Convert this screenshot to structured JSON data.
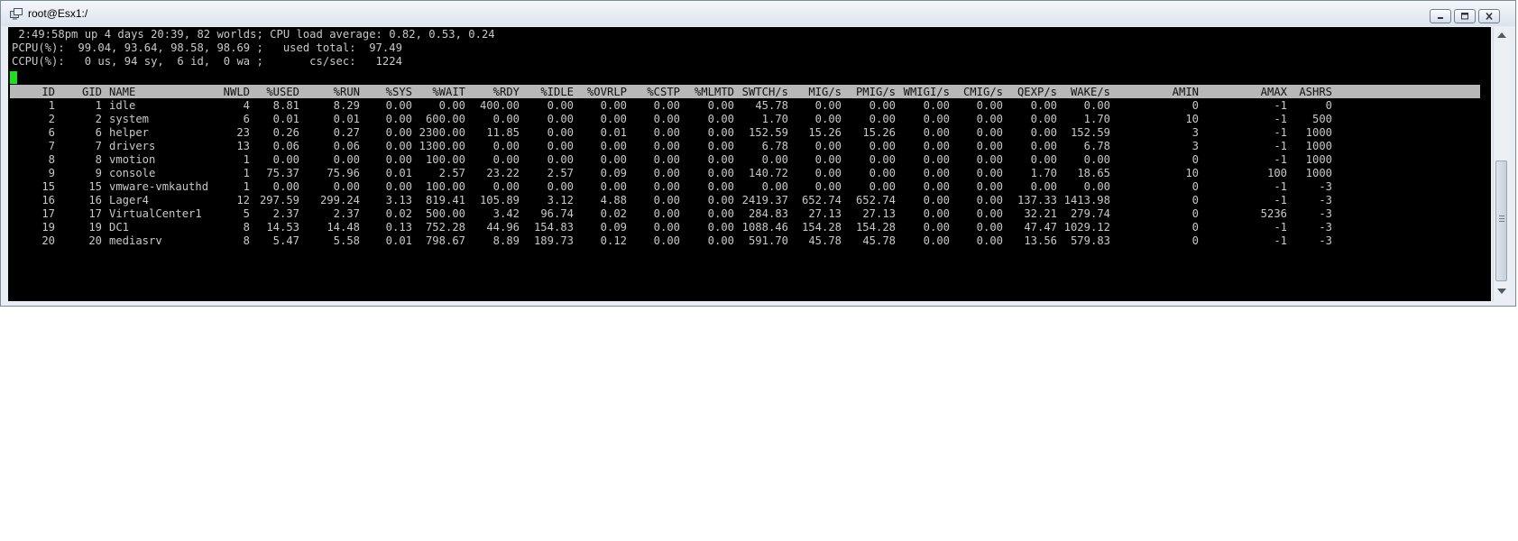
{
  "window": {
    "title": "root@Esx1:/"
  },
  "summary": {
    "line1": " 2:49:58pm up 4 days 20:39, 82 worlds; CPU load average: 0.82, 0.53, 0.24",
    "line2": "PCPU(%):  99.04, 93.64, 98.58, 98.69 ;   used total:  97.49",
    "line3": "CCPU(%):   0 us, 94 sy,  6 id,  0 wa ;       cs/sec:   1224"
  },
  "columns": [
    "ID",
    "GID",
    "NAME",
    "NWLD",
    "%USED",
    "%RUN",
    "%SYS",
    "%WAIT",
    "%RDY",
    "%IDLE",
    "%OVRLP",
    "%CSTP",
    "%MLMTD",
    "SWTCH/s",
    "MIG/s",
    "PMIG/s",
    "WMIGI/s",
    "CMIG/s",
    "QEXP/s",
    "WAKE/s",
    "AMIN",
    "AMAX",
    "ASHRS"
  ],
  "rows": [
    [
      "1",
      "1",
      "idle",
      "4",
      "8.81",
      "8.29",
      "0.00",
      "0.00",
      "400.00",
      "0.00",
      "0.00",
      "0.00",
      "0.00",
      "45.78",
      "0.00",
      "0.00",
      "0.00",
      "0.00",
      "0.00",
      "0.00",
      "0",
      "-1",
      "0"
    ],
    [
      "2",
      "2",
      "system",
      "6",
      "0.01",
      "0.01",
      "0.00",
      "600.00",
      "0.00",
      "0.00",
      "0.00",
      "0.00",
      "0.00",
      "1.70",
      "0.00",
      "0.00",
      "0.00",
      "0.00",
      "0.00",
      "1.70",
      "10",
      "-1",
      "500"
    ],
    [
      "6",
      "6",
      "helper",
      "23",
      "0.26",
      "0.27",
      "0.00",
      "2300.00",
      "11.85",
      "0.00",
      "0.01",
      "0.00",
      "0.00",
      "152.59",
      "15.26",
      "15.26",
      "0.00",
      "0.00",
      "0.00",
      "152.59",
      "3",
      "-1",
      "1000"
    ],
    [
      "7",
      "7",
      "drivers",
      "13",
      "0.06",
      "0.06",
      "0.00",
      "1300.00",
      "0.00",
      "0.00",
      "0.00",
      "0.00",
      "0.00",
      "6.78",
      "0.00",
      "0.00",
      "0.00",
      "0.00",
      "0.00",
      "6.78",
      "3",
      "-1",
      "1000"
    ],
    [
      "8",
      "8",
      "vmotion",
      "1",
      "0.00",
      "0.00",
      "0.00",
      "100.00",
      "0.00",
      "0.00",
      "0.00",
      "0.00",
      "0.00",
      "0.00",
      "0.00",
      "0.00",
      "0.00",
      "0.00",
      "0.00",
      "0.00",
      "0",
      "-1",
      "1000"
    ],
    [
      "9",
      "9",
      "console",
      "1",
      "75.37",
      "75.96",
      "0.01",
      "2.57",
      "23.22",
      "2.57",
      "0.09",
      "0.00",
      "0.00",
      "140.72",
      "0.00",
      "0.00",
      "0.00",
      "0.00",
      "1.70",
      "18.65",
      "10",
      "100",
      "1000"
    ],
    [
      "15",
      "15",
      "vmware-vmkauthd",
      "1",
      "0.00",
      "0.00",
      "0.00",
      "100.00",
      "0.00",
      "0.00",
      "0.00",
      "0.00",
      "0.00",
      "0.00",
      "0.00",
      "0.00",
      "0.00",
      "0.00",
      "0.00",
      "0.00",
      "0",
      "-1",
      "-3"
    ],
    [
      "16",
      "16",
      "Lager4",
      "12",
      "297.59",
      "299.24",
      "3.13",
      "819.41",
      "105.89",
      "3.12",
      "4.88",
      "0.00",
      "0.00",
      "2419.37",
      "652.74",
      "652.74",
      "0.00",
      "0.00",
      "137.33",
      "1413.98",
      "0",
      "-1",
      "-3"
    ],
    [
      "17",
      "17",
      "VirtualCenter1",
      "5",
      "2.37",
      "2.37",
      "0.02",
      "500.00",
      "3.42",
      "96.74",
      "0.02",
      "0.00",
      "0.00",
      "284.83",
      "27.13",
      "27.13",
      "0.00",
      "0.00",
      "32.21",
      "279.74",
      "0",
      "5236",
      "-3"
    ],
    [
      "19",
      "19",
      "DC1",
      "8",
      "14.53",
      "14.48",
      "0.13",
      "752.28",
      "44.96",
      "154.83",
      "0.09",
      "0.00",
      "0.00",
      "1088.46",
      "154.28",
      "154.28",
      "0.00",
      "0.00",
      "47.47",
      "1029.12",
      "0",
      "-1",
      "-3"
    ],
    [
      "20",
      "20",
      "mediasrv",
      "8",
      "5.47",
      "5.58",
      "0.01",
      "798.67",
      "8.89",
      "189.73",
      "0.12",
      "0.00",
      "0.00",
      "591.70",
      "45.78",
      "45.78",
      "0.00",
      "0.00",
      "13.56",
      "579.83",
      "0",
      "-1",
      "-3"
    ]
  ],
  "colors": {
    "terminal_bg": "#000000",
    "terminal_fg": "#c8c8c8",
    "header_bar": "#b8b8b8",
    "cursor": "#1ee01e"
  },
  "icons": [
    "app-icon",
    "minimize-icon",
    "maximize-icon",
    "close-icon"
  ]
}
